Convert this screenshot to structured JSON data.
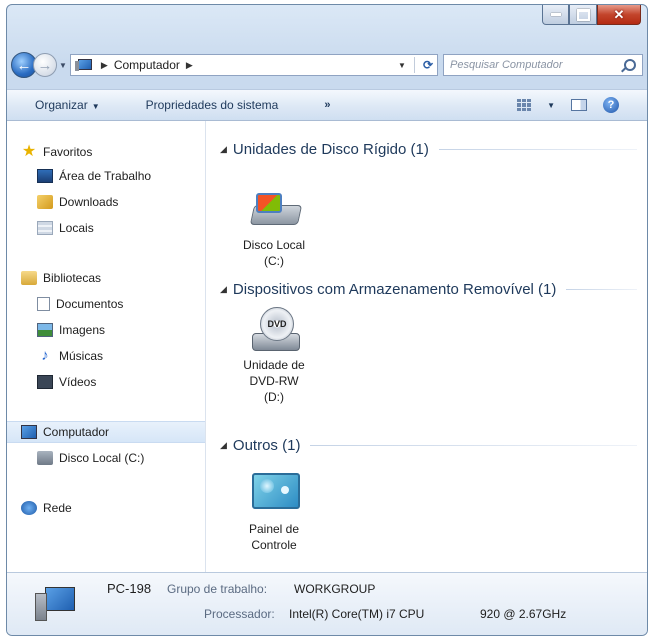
{
  "window": {
    "caption_buttons": [
      "minimize-icon",
      "maximize-icon",
      "close-icon"
    ]
  },
  "address": {
    "crumb": "Computador",
    "search_placeholder": "Pesquisar Computador"
  },
  "toolbar": {
    "organize": "Organizar",
    "system_properties": "Propriedades do sistema",
    "more": "»"
  },
  "sidebar": {
    "favorites": "Favoritos",
    "desktop": "Área de Trabalho",
    "downloads": "Downloads",
    "places": "Locais",
    "libraries": "Bibliotecas",
    "documents": "Documentos",
    "images": "Imagens",
    "music": "Músicas",
    "videos": "Vídeos",
    "computer": "Computador",
    "local_disk": "Disco Local (C:)",
    "network": "Rede"
  },
  "main": {
    "groups": [
      {
        "title": "Unidades de Disco Rígido (1)"
      },
      {
        "title": "Dispositivos com Armazenamento Removível (1)"
      },
      {
        "title": "Outros (1)"
      }
    ],
    "items": [
      {
        "line1": "Disco Local",
        "line2": "(C:)",
        "icon": "hard-disk-icon"
      },
      {
        "line1": "Unidade de",
        "line2": "DVD-RW",
        "line3": "(D:)",
        "icon": "dvd-drive-icon"
      },
      {
        "line1": "Painel de",
        "line2": "Controle",
        "icon": "control-panel-icon"
      }
    ]
  },
  "details": {
    "computer_name": "PC-198",
    "workgroup_label": "Grupo de trabalho:",
    "workgroup_value": "WORKGROUP",
    "processor_label": "Processador:",
    "processor_value": "Intel(R) Core(TM) i7 CPU",
    "processor_speed": "920 @ 2.67GHz"
  }
}
